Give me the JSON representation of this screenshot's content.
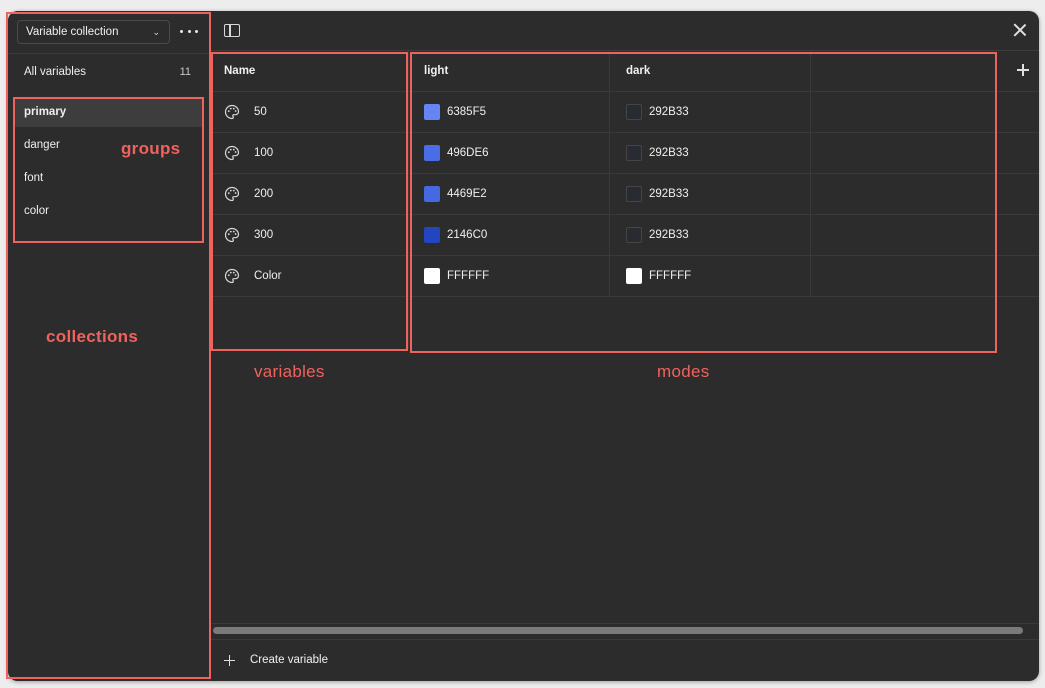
{
  "sidebar": {
    "collection_select": "Variable collection",
    "all_variables_label": "All variables",
    "all_variables_count": "11",
    "groups": [
      {
        "label": "primary",
        "active": true
      },
      {
        "label": "danger",
        "active": false
      },
      {
        "label": "font",
        "active": false
      },
      {
        "label": "color",
        "active": false
      }
    ]
  },
  "table": {
    "headers": {
      "name": "Name",
      "light": "light",
      "dark": "dark"
    },
    "rows": [
      {
        "name": "50",
        "light": {
          "hex": "6385F5",
          "color": "#6385F5"
        },
        "dark": {
          "hex": "292B33",
          "color": "#292B33"
        }
      },
      {
        "name": "100",
        "light": {
          "hex": "496DE6",
          "color": "#496DE6"
        },
        "dark": {
          "hex": "292B33",
          "color": "#292B33"
        }
      },
      {
        "name": "200",
        "light": {
          "hex": "4469E2",
          "color": "#4469E2"
        },
        "dark": {
          "hex": "292B33",
          "color": "#292B33"
        }
      },
      {
        "name": "300",
        "light": {
          "hex": "2146C0",
          "color": "#2146C0"
        },
        "dark": {
          "hex": "292B33",
          "color": "#292B33"
        }
      },
      {
        "name": "Color",
        "light": {
          "hex": "FFFFFF",
          "color": "#FFFFFF"
        },
        "dark": {
          "hex": "FFFFFF",
          "color": "#FFFFFF"
        }
      }
    ]
  },
  "footer": {
    "create_variable": "Create variable"
  },
  "annotations": {
    "groups": "groups",
    "collections": "collections",
    "variables": "variables",
    "modes": "modes",
    "color": "#f0625e"
  },
  "icons": {
    "more": "more-horizontal-icon",
    "panel": "sidebar-toggle-icon",
    "close": "close-icon",
    "add": "plus-icon",
    "variable": "palette-icon"
  }
}
